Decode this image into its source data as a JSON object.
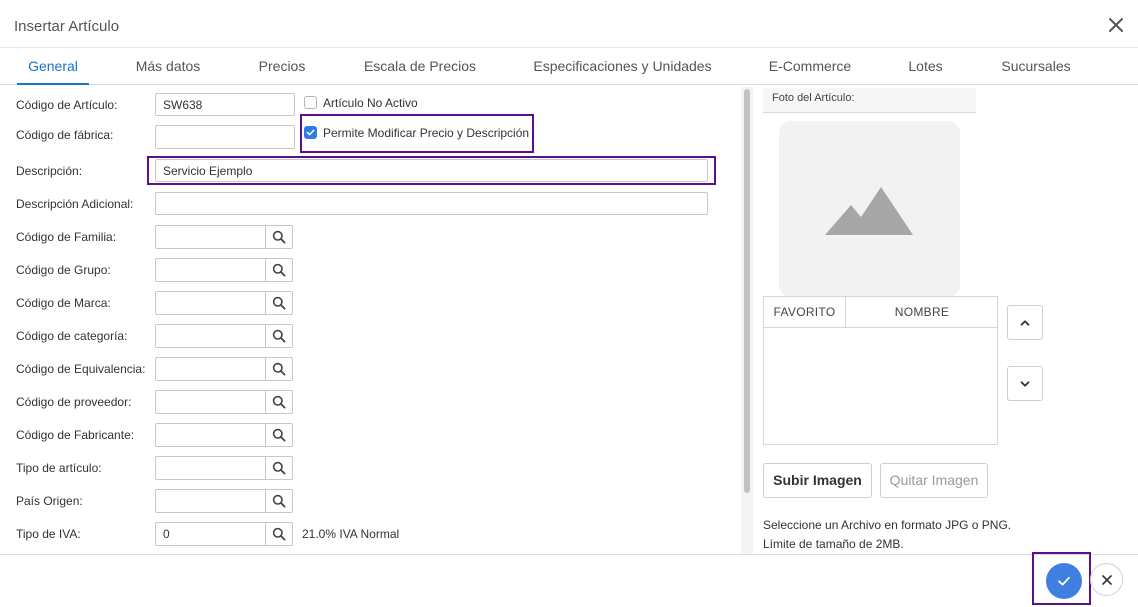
{
  "dialog": {
    "title": "Insertar Artículo"
  },
  "tabs": [
    {
      "label": "General"
    },
    {
      "label": "Más datos"
    },
    {
      "label": "Precios"
    },
    {
      "label": "Escala de Precios"
    },
    {
      "label": "Especificaciones y Unidades"
    },
    {
      "label": "E-Commerce"
    },
    {
      "label": "Lotes"
    },
    {
      "label": "Sucursales"
    }
  ],
  "form": {
    "codigo_articulo": {
      "label": "Código de Artículo:",
      "value": "SW638"
    },
    "codigo_fabrica": {
      "label": "Código de fábrica:",
      "value": ""
    },
    "articulo_no_activo": {
      "label": "Artículo No Activo",
      "checked": false
    },
    "permite_modificar": {
      "label": "Permite Modificar Precio y Descripción",
      "checked": true
    },
    "descripcion": {
      "label": "Descripción:",
      "value": "Servicio Ejemplo"
    },
    "descripcion_adicional": {
      "label": "Descripción Adicional:",
      "value": ""
    },
    "lookups": [
      {
        "label": "Código de Familia:",
        "value": ""
      },
      {
        "label": "Código de Grupo:",
        "value": ""
      },
      {
        "label": "Código de Marca:",
        "value": ""
      },
      {
        "label": "Código de categoría:",
        "value": ""
      },
      {
        "label": "Código de Equivalencia:",
        "value": ""
      },
      {
        "label": "Código de proveedor:",
        "value": ""
      },
      {
        "label": "Código de Fabricante:",
        "value": ""
      },
      {
        "label": "Tipo de artículo:",
        "value": ""
      },
      {
        "label": "País Origen:",
        "value": ""
      },
      {
        "label": "Tipo de IVA:",
        "value": "0",
        "info": "21.0% IVA Normal"
      }
    ]
  },
  "photo": {
    "label": "Foto del Artículo:",
    "table_headers": {
      "favorito": "FAVORITO",
      "nombre": "NOMBRE"
    },
    "upload_label": "Subir Imagen",
    "remove_label": "Quitar Imagen",
    "note_line1": "Seleccione un Archivo en formato JPG o PNG.",
    "note_line2": "Límite de tamaño de 2MB."
  },
  "colors": {
    "accent": "#1a73c8",
    "confirm": "#3f7fe0",
    "highlight": "#5b0f8e"
  }
}
